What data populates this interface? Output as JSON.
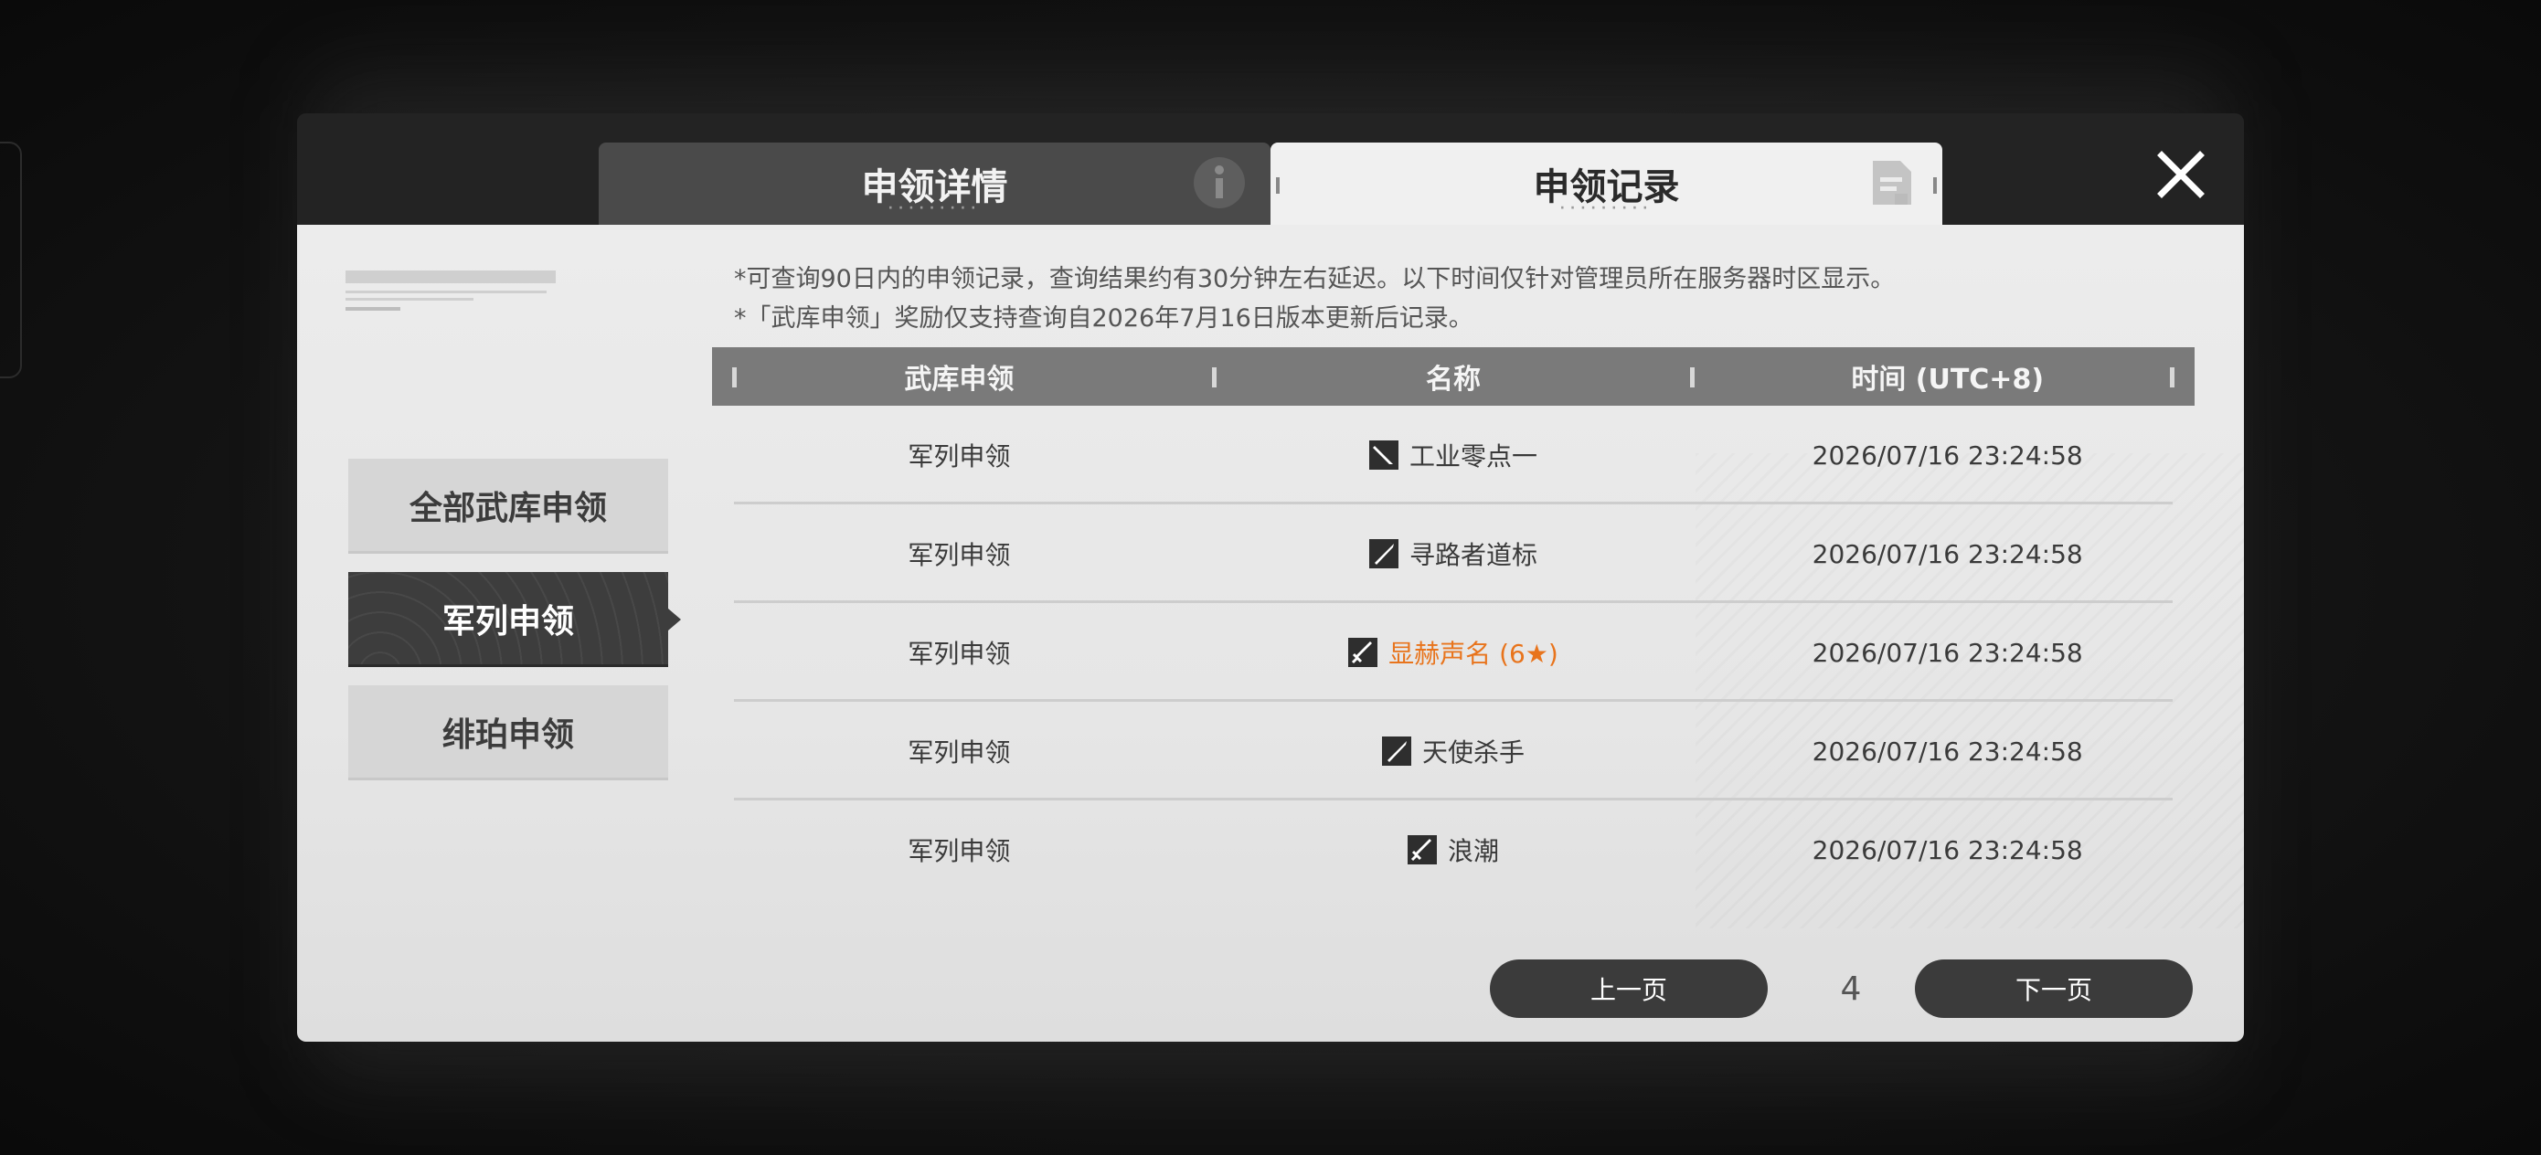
{
  "tabs": {
    "details_label": "申领详情",
    "records_label": "申领记录"
  },
  "sidebar": {
    "items": [
      {
        "label": "全部武库申领"
      },
      {
        "label": "军列申领"
      },
      {
        "label": "绯珀申领"
      }
    ],
    "active_index": 1
  },
  "notes": [
    "*可查询90日内的申领记录，查询结果约有30分钟左右延迟。以下时间仅针对管理员所在服务器时区显示。",
    "*「武库申领」奖励仅支持查询自2026年7月16日版本更新后记录。"
  ],
  "table": {
    "columns": [
      "武库申领",
      "名称",
      "时间 (UTC+8)"
    ],
    "rows": [
      {
        "type": "军列申领",
        "name": "工业零点一",
        "time": "2026/07/16 23:24:58",
        "icon": "blade-icon",
        "rare": false
      },
      {
        "type": "军列申领",
        "name": "寻路者道标",
        "time": "2026/07/16 23:24:58",
        "icon": "lance-icon",
        "rare": false
      },
      {
        "type": "军列申领",
        "name": "显赫声名 (6★)",
        "time": "2026/07/16 23:24:58",
        "icon": "sword-icon",
        "rare": true
      },
      {
        "type": "军列申领",
        "name": "天使杀手",
        "time": "2026/07/16 23:24:58",
        "icon": "lance-icon",
        "rare": false
      },
      {
        "type": "军列申领",
        "name": "浪潮",
        "time": "2026/07/16 23:24:58",
        "icon": "sword-icon",
        "rare": false
      }
    ]
  },
  "pager": {
    "prev_label": "上一页",
    "next_label": "下一页",
    "current_page": "4"
  },
  "colors": {
    "rare": "#e8741c",
    "accent_dark": "#3b3b3b",
    "header_gray": "#7a7a7a"
  }
}
